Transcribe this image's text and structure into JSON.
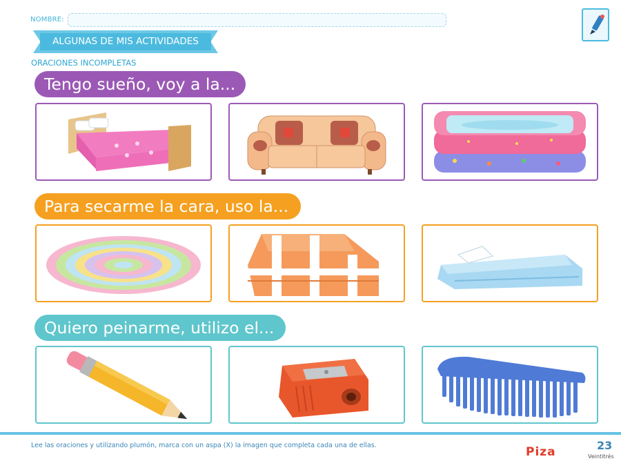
{
  "header": {
    "name_label": "NOMBRE:",
    "ribbon_title": "ALGUNAS DE MIS ACTIVIDADES",
    "subheading": "ORACIONES INCOMPLETAS"
  },
  "activities": [
    {
      "prompt": "Tengo sueño, voy a la...",
      "color": "#9b59b5",
      "options": [
        "bed",
        "sofa",
        "inflatable-pool"
      ]
    },
    {
      "prompt": "Para secarme la cara, uso la...",
      "color": "#f5a020",
      "options": [
        "round-rug",
        "striped-blanket",
        "folded-towel"
      ]
    },
    {
      "prompt": "Quiero peinarme, utilizo el...",
      "color": "#5ec6cc",
      "options": [
        "pencil",
        "pencil-sharpener",
        "comb"
      ]
    }
  ],
  "footer": {
    "instruction": "Lee las oraciones y utilizando plumón, marca con un aspa (X) la imagen que completa cada una de ellas.",
    "brand": "Piza",
    "page_number": "23",
    "page_word": "Veintitrés"
  },
  "icons": {
    "edit": "marker-pen-icon"
  }
}
